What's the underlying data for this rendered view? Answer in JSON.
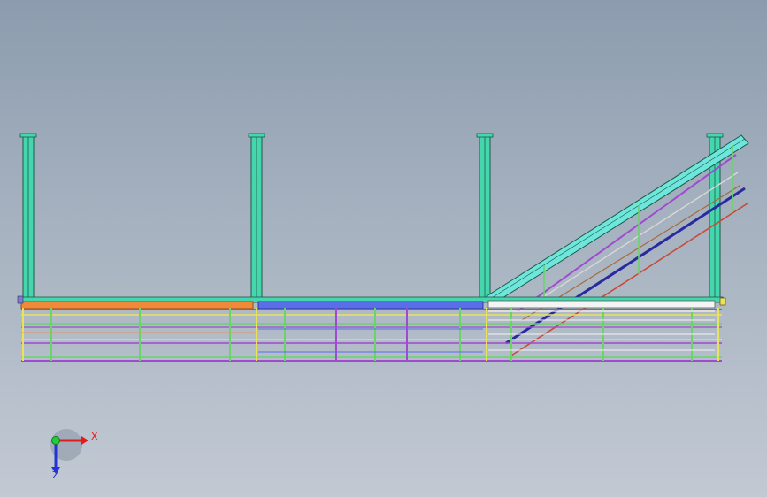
{
  "triad": {
    "x_label": "X",
    "z_label": "Z",
    "x_color": "#e01c1c",
    "y_color": "#1fcf3a",
    "z_color": "#2432d6"
  },
  "colors": {
    "post": "#46d6ae",
    "stringer": "#6fe6dc",
    "deck_orange": "#f08a3a",
    "deck_blue": "#5a6ee8",
    "deck_white": "#f4f4f4",
    "rail_yellow": "#e9e35a",
    "rail_green": "#6ad36a",
    "rail_purple": "#a04ad0",
    "rail_navy": "#2a2aa0",
    "rail_red": "#c84a3a",
    "rail_brown": "#a8683a"
  }
}
